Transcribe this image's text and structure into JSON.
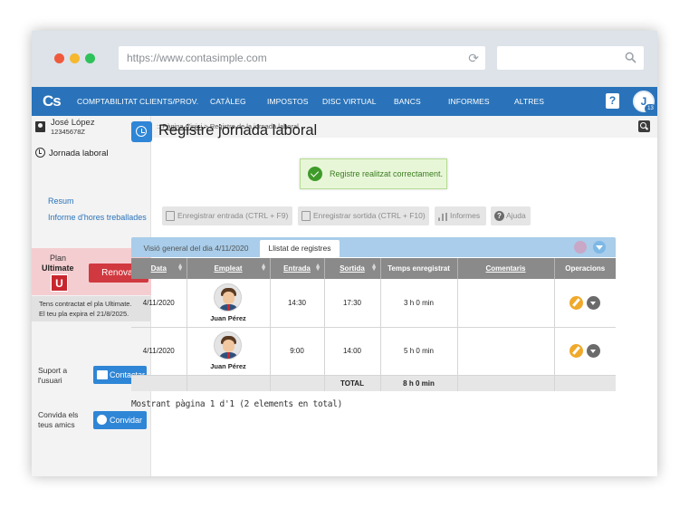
{
  "browser": {
    "url": "https://www.contasimple.com"
  },
  "nav": {
    "logo": "Cs",
    "items": [
      "COMPTABILITAT",
      "CLIENTS/PROV.",
      "CATÀLEG",
      "IMPOSTOS",
      "DISC VIRTUAL",
      "BANCS",
      "INFORMES",
      "ALTRES"
    ],
    "help": "?",
    "avatar_initial": "J",
    "avatar_badge": "13"
  },
  "sidebar": {
    "user_name": "José López",
    "user_code": "12345678Z",
    "section_title": "Jornada laboral",
    "links": [
      "Resum",
      "Informe d'hores treballades"
    ],
    "plan_label": "Plan",
    "plan_name": "Ultimate",
    "plan_badge": "U",
    "renew_button": "Renovar",
    "plan_note_line1": "Tens contractat el pla Ultimate.",
    "plan_note_line2": "El teu pla expira el 21/8/2025.",
    "support_label_line1": "Suport a",
    "support_label_line2": "l'usuari",
    "contact_button": "Contactar",
    "invite_label_line1": "Convida els",
    "invite_label_line2": "teus amics",
    "invite_button": "Convidar"
  },
  "breadcrumb": {
    "prefix": "::",
    "home": "Pàgina d'inici",
    "separator": ">",
    "current": "Registre de la jornada laboral"
  },
  "page": {
    "title": "Registre jornada laboral",
    "success_message": "Registre realitzat correctament."
  },
  "toolbar": {
    "entry": "Enregistrar entrada (CTRL + F9)",
    "exit": "Enregistrar sortida (CTRL + F10)",
    "reports": "Informes",
    "help": "Ajuda"
  },
  "tabs": {
    "overview": "Visió general del dia 4/11/2020",
    "list": "Llistat de registres"
  },
  "table": {
    "headers": [
      "Data",
      "Empleat",
      "Entrada",
      "Sortida",
      "Temps enregistrat",
      "Comentaris",
      "Operacions"
    ],
    "rows": [
      {
        "date": "4/11/2020",
        "employee": "Juan Pérez",
        "entry": "14:30",
        "exit": "17:30",
        "time": "3 h 0 min",
        "comments": ""
      },
      {
        "date": "4/11/2020",
        "employee": "Juan Pérez",
        "entry": "9:00",
        "exit": "14:00",
        "time": "5 h 0 min",
        "comments": ""
      }
    ],
    "total_label": "TOTAL",
    "total_value": "8 h 0 min"
  },
  "footer": {
    "text": "Mostrant pàgina 1 d'1 (2 elements en total)"
  },
  "colors": {
    "nav": "#2a73ba",
    "accent_button": "#2f86d6",
    "renew_button": "#d0393f",
    "plan_background": "#f4cdd0",
    "success_background": "#e8f6d8",
    "table_header": "#8a8a8a",
    "tab_bar": "#a9cdea"
  },
  "icons": {
    "refresh": "refresh-icon",
    "search": "search-icon",
    "id_card": "id-card-icon",
    "swap": "swap-icon",
    "clock": "clock-history-icon",
    "envelope": "envelope-icon",
    "globe": "globe-icon",
    "checkmark": "check-circle-icon",
    "edit": "pencil-icon",
    "dropdown": "chevron-down-icon"
  }
}
